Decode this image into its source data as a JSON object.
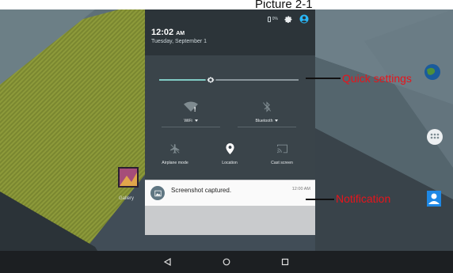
{
  "caption": "Picture 2-1",
  "status_bar": {
    "battery_text": "0%",
    "icons": [
      "battery-icon",
      "settings-gear-icon",
      "account-icon"
    ]
  },
  "header": {
    "time": "12:02",
    "ampm": "AM",
    "date": "Tuesday, September 1"
  },
  "quick_settings": {
    "brightness": {
      "level_fraction": 0.37
    },
    "tiles": [
      {
        "name": "wifi",
        "label": "WiFi",
        "has_dropdown": true,
        "icon": "wifi-off-icon",
        "active": false
      },
      {
        "name": "bluetooth",
        "label": "Bluetooth",
        "has_dropdown": true,
        "icon": "bluetooth-off-icon",
        "active": false
      },
      {
        "name": "airplane",
        "label": "Airplane mode",
        "has_dropdown": false,
        "icon": "airplane-icon",
        "active": false
      },
      {
        "name": "location",
        "label": "Location",
        "has_dropdown": false,
        "icon": "location-pin-icon",
        "active": true
      },
      {
        "name": "cast",
        "label": "Cast screen",
        "has_dropdown": false,
        "icon": "cast-icon",
        "active": false
      }
    ]
  },
  "notification": {
    "title": "Screenshot captured.",
    "time": "12:00 AM",
    "icon": "image-icon"
  },
  "annotations": {
    "quick_settings": "Quick settings",
    "notification": "Notification"
  },
  "home": {
    "gallery_label": "Gallery"
  },
  "nav": [
    "back-icon",
    "home-icon",
    "recents-icon"
  ],
  "colors": {
    "accent": "#80cbc4",
    "shade_header": "#2c3439",
    "shade_panel": "#3a444a",
    "annotation_red": "#e8141b",
    "account_blue": "#29b6f6"
  }
}
